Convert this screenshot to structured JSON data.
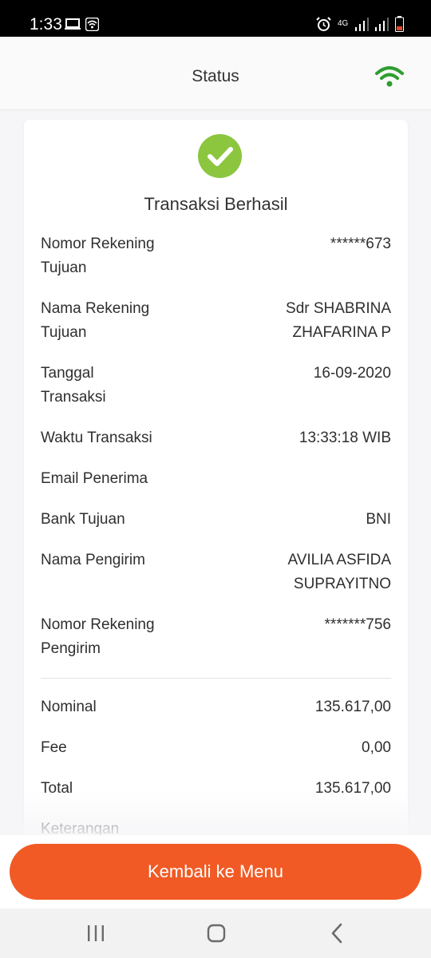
{
  "status_bar": {
    "time": "1:33",
    "network_label": "4G"
  },
  "app_bar": {
    "title": "Status"
  },
  "card": {
    "title": "Transaksi Berhasil",
    "rows": [
      {
        "label": "Nomor Rekening Tujuan",
        "value": "******673"
      },
      {
        "label": "Nama Rekening Tujuan",
        "value": "Sdr SHABRINA ZHAFARINA P"
      },
      {
        "label": "Tanggal Transaksi",
        "value": "16-09-2020"
      },
      {
        "label": "Waktu Transaksi",
        "value": "13:33:18 WIB"
      },
      {
        "label": "Email Penerima",
        "value": ""
      },
      {
        "label": "Bank Tujuan",
        "value": "BNI"
      },
      {
        "label": "Nama Pengirim",
        "value": "AVILIA ASFIDA SUPRAYITNO"
      },
      {
        "label": "Nomor Rekening Pengirim",
        "value": "*******756"
      }
    ],
    "amounts": [
      {
        "label": "Nominal",
        "value": "135.617,00"
      },
      {
        "label": "Fee",
        "value": "0,00"
      },
      {
        "label": "Total",
        "value": "135.617,00"
      },
      {
        "label": "Keterangan",
        "value": ""
      }
    ]
  },
  "actions": {
    "back_label": "Kembali ke Menu"
  },
  "colors": {
    "accent": "#f15a24",
    "success": "#8cc63f",
    "signal_green": "#2e9e2e"
  }
}
